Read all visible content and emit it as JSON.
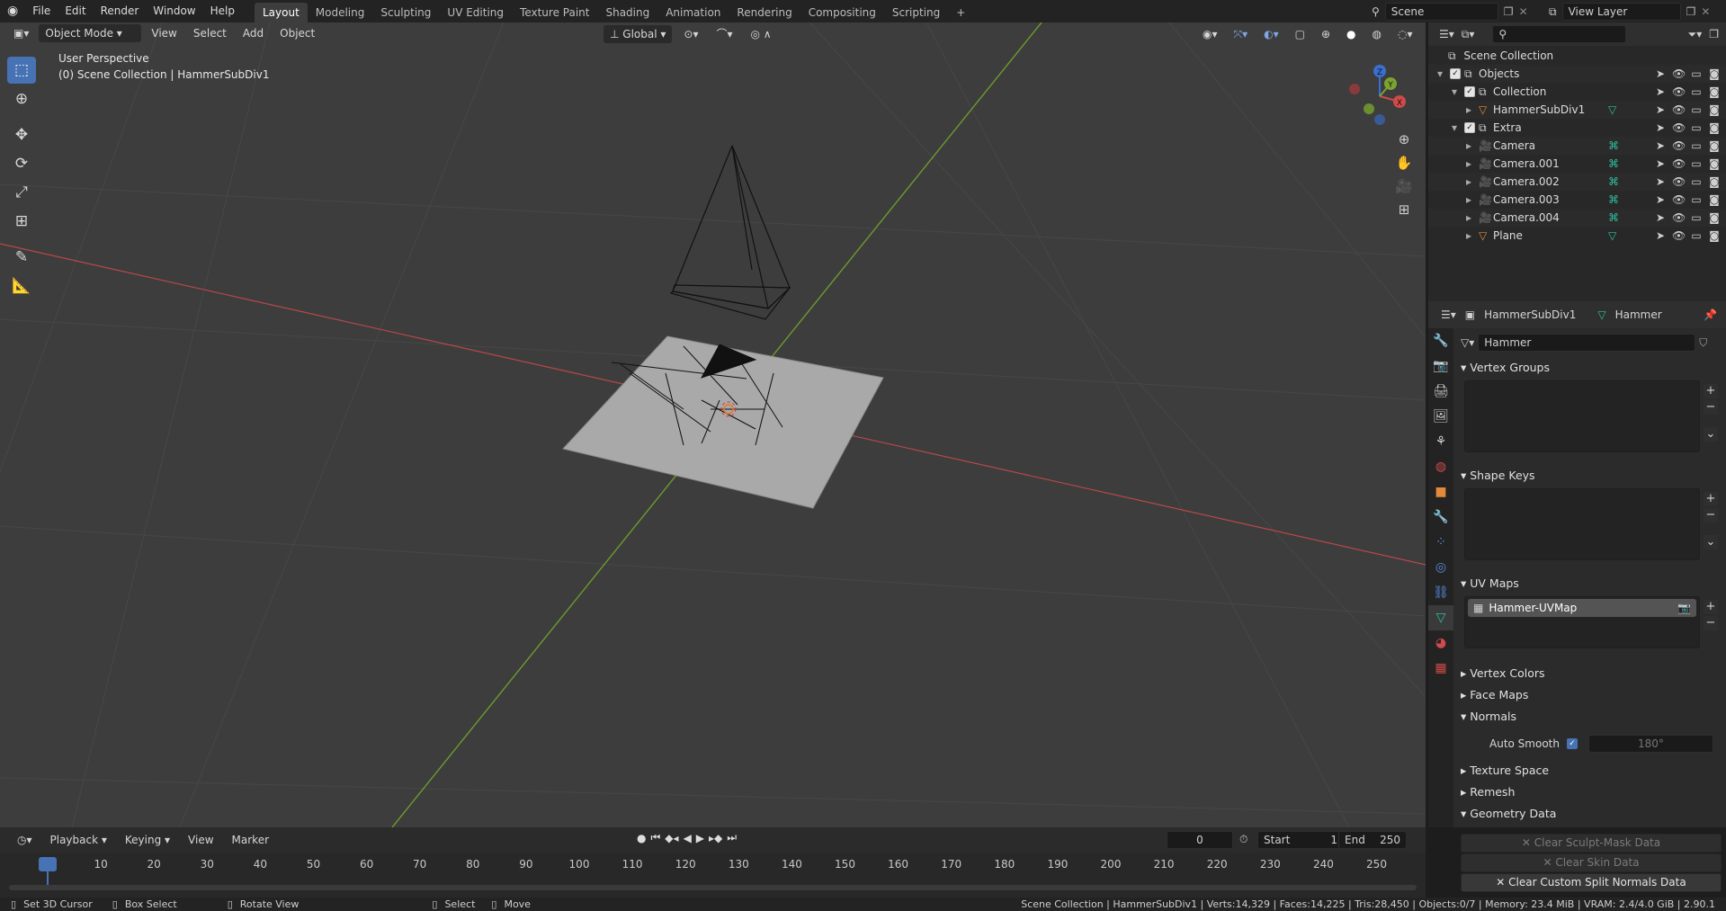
{
  "topbar": {
    "menus": [
      "File",
      "Edit",
      "Render",
      "Window",
      "Help"
    ],
    "workspaces": [
      "Layout",
      "Modeling",
      "Sculpting",
      "UV Editing",
      "Texture Paint",
      "Shading",
      "Animation",
      "Rendering",
      "Compositing",
      "Scripting"
    ],
    "active_workspace": "Layout",
    "add_workspace": "+",
    "scene_name": "Scene",
    "view_layer": "View Layer"
  },
  "viewport": {
    "mode": "Object Mode",
    "menus": [
      "View",
      "Select",
      "Add",
      "Object"
    ],
    "transform_orientation": "Global",
    "info_line1": "User Perspective",
    "info_line2": "(0) Scene Collection | HammerSubDiv1",
    "gizmo_axes": {
      "x": "X",
      "y": "Y",
      "z": "Z"
    }
  },
  "outliner": {
    "search_placeholder": "",
    "root": "Scene Collection",
    "rows": [
      {
        "label": "Objects",
        "indent": 1,
        "type": "collection"
      },
      {
        "label": "Collection",
        "indent": 2,
        "type": "collection"
      },
      {
        "label": "HammerSubDiv1",
        "indent": 3,
        "type": "mesh"
      },
      {
        "label": "Extra",
        "indent": 2,
        "type": "collection"
      },
      {
        "label": "Camera",
        "indent": 3,
        "type": "camera"
      },
      {
        "label": "Camera.001",
        "indent": 3,
        "type": "camera"
      },
      {
        "label": "Camera.002",
        "indent": 3,
        "type": "camera"
      },
      {
        "label": "Camera.003",
        "indent": 3,
        "type": "camera"
      },
      {
        "label": "Camera.004",
        "indent": 3,
        "type": "camera"
      },
      {
        "label": "Plane",
        "indent": 3,
        "type": "mesh"
      }
    ]
  },
  "properties": {
    "object_name": "HammerSubDiv1",
    "data_name": "Hammer",
    "mesh_field": "Hammer",
    "panels": {
      "vertex_groups": "Vertex Groups",
      "shape_keys": "Shape Keys",
      "uv_maps": "UV Maps",
      "vertex_colors": "Vertex Colors",
      "face_maps": "Face Maps",
      "normals": "Normals",
      "texture_space": "Texture Space",
      "remesh": "Remesh",
      "geometry_data": "Geometry Data"
    },
    "uv_map_item": "Hammer-UVMap",
    "auto_smooth_label": "Auto Smooth",
    "auto_smooth_angle": "180°",
    "geometry_buttons": [
      "Clear Sculpt-Mask Data",
      "Clear Skin Data",
      "Clear Custom Split Normals Data"
    ]
  },
  "timeline": {
    "menus": [
      "Playback",
      "Keying",
      "View",
      "Marker"
    ],
    "current_frame": "0",
    "start_label": "Start",
    "start_value": "1",
    "end_label": "End",
    "end_value": "250",
    "ticks": [
      "0",
      "10",
      "20",
      "30",
      "40",
      "50",
      "60",
      "70",
      "80",
      "90",
      "100",
      "110",
      "120",
      "130",
      "140",
      "150",
      "160",
      "170",
      "180",
      "190",
      "200",
      "210",
      "220",
      "230",
      "240",
      "250"
    ]
  },
  "statusbar": {
    "hints": [
      "Set 3D Cursor",
      "Box Select",
      "Rotate View",
      "Select",
      "Move"
    ],
    "stats": "Scene Collection | HammerSubDiv1 | Verts:14,329 | Faces:14,225 | Tris:28,450 | Objects:0/7 | Memory: 23.4 MiB | VRAM: 2.4/4.0 GiB | 2.90.1"
  },
  "colors": {
    "accent": "#4772b3",
    "x_axis": "#d04a4a",
    "y_axis": "#7aa332",
    "camera_icon": "#e28a3c",
    "mesh_icon": "#2fbfa0"
  }
}
